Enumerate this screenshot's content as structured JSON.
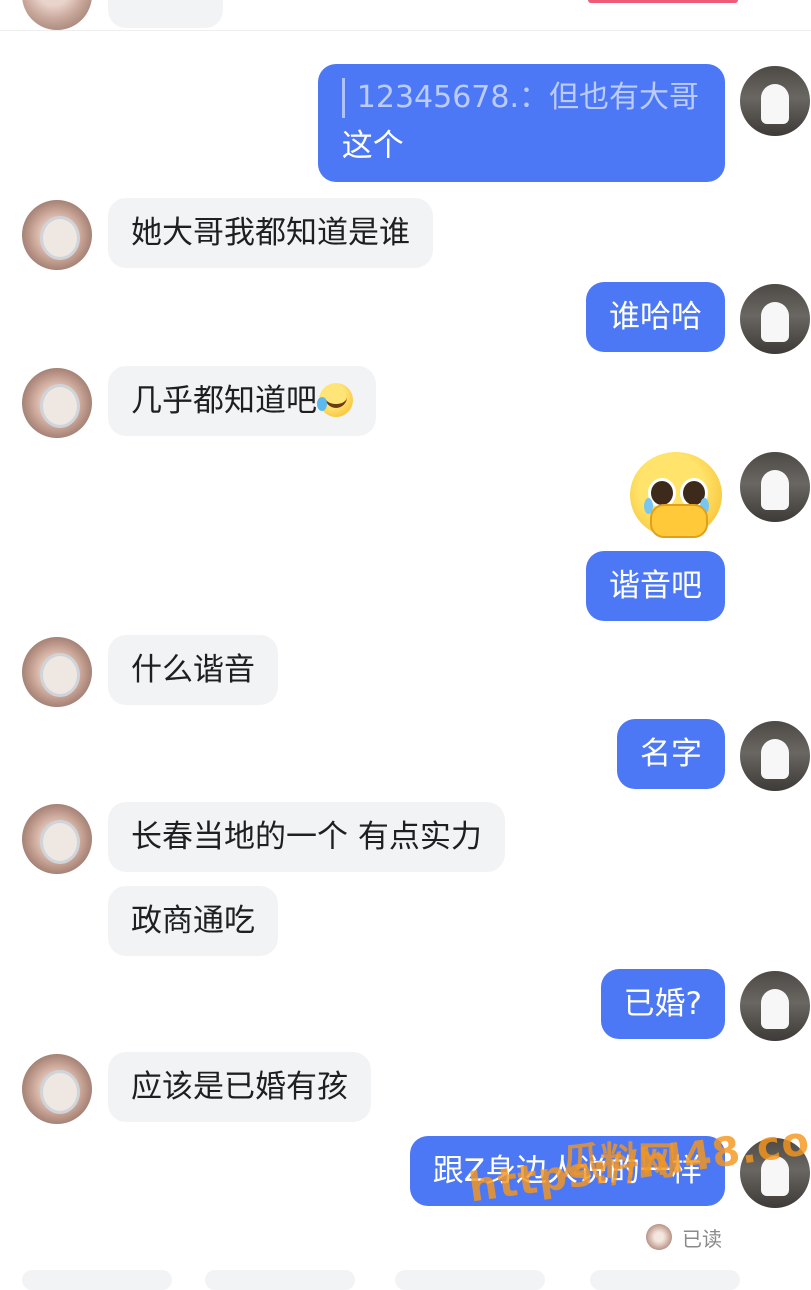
{
  "messages": [
    {
      "quote": "12345678.：但也有大哥",
      "text": "这个"
    },
    {
      "text": "她大哥我都知道是谁"
    },
    {
      "text": "谁哈哈"
    },
    {
      "text": "几乎都知道吧"
    },
    {
      "emoji": "pleading-face-covering-mouth"
    },
    {
      "text": "谐音吧"
    },
    {
      "text": "什么谐音"
    },
    {
      "text": "名字"
    },
    {
      "text": "长春当地的一个 有点实力"
    },
    {
      "text": "政商通吃"
    },
    {
      "text": "已婚?"
    },
    {
      "text": "应该是已婚有孩"
    },
    {
      "text": "跟Z身边人说的一样"
    }
  ],
  "read_status": "已读",
  "watermark": {
    "site": "瓜料网",
    "url": "https://hl48.co"
  },
  "colors": {
    "outgoing": "#4c78f5",
    "incoming": "#f2f3f5",
    "accent_top": "#f05a78"
  },
  "icons": {
    "laugh_emoji": "laughing-with-tears-emoji"
  }
}
